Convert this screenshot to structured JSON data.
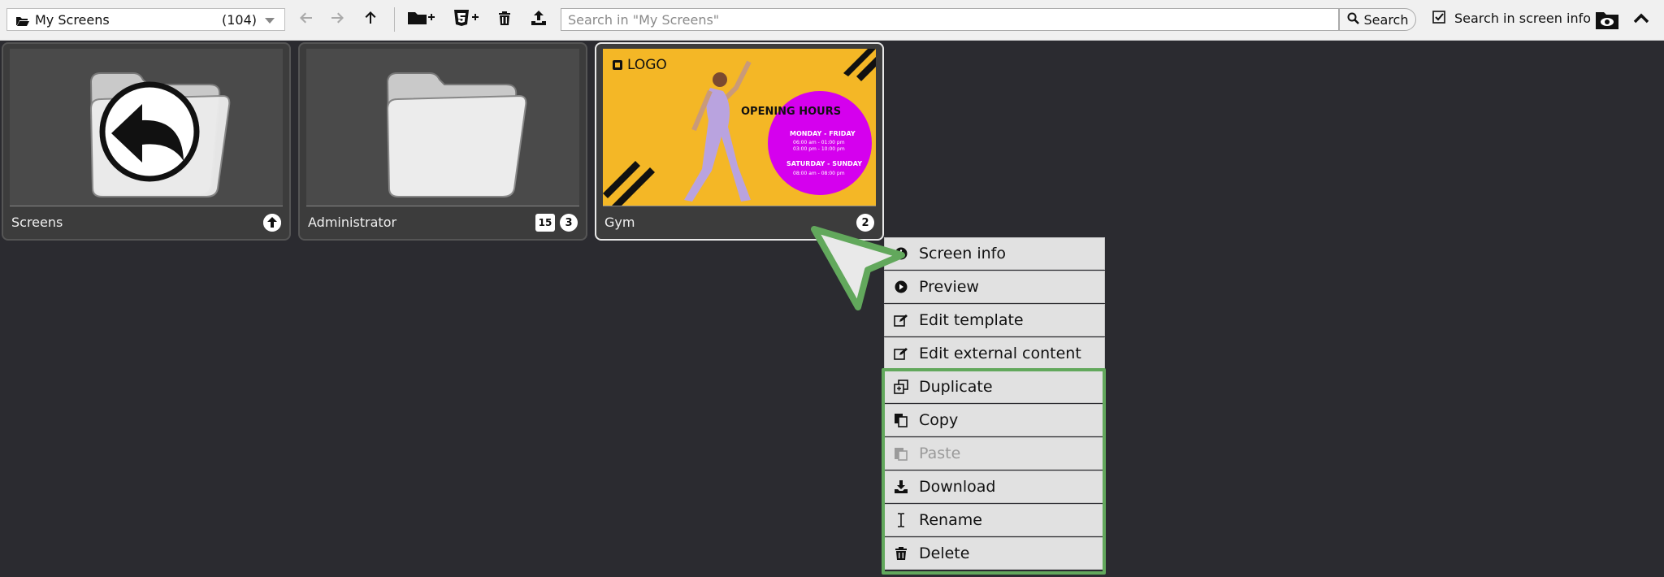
{
  "toolbar": {
    "folder_name": "My Screens",
    "folder_count": "(104)",
    "search_placeholder": "Search in \"My Screens\"",
    "search_button": "Search",
    "search_in_info_label": "Search in screen info",
    "search_in_info_checked": true,
    "icons": [
      "open-folder-icon",
      "back-arrow-icon",
      "forward-arrow-icon",
      "up-arrow-icon",
      "new-folder-icon",
      "new-html5-screen-icon",
      "trash-icon",
      "upload-icon",
      "search-icon",
      "checkbox-icon",
      "folder-eye-icon",
      "chevron-up-icon"
    ]
  },
  "tiles": [
    {
      "label": "Screens",
      "icon": "up-arrow-circle-icon"
    },
    {
      "label": "Administrator",
      "badge_screens": "15",
      "badge_folders": "3"
    },
    {
      "label": "Gym",
      "badge": "2",
      "selected": true,
      "poster": {
        "logo": "LOGO",
        "heading": "OPENING HOURS",
        "days1": "MONDAY - FRIDAY",
        "time1": "06:00 am - 01:00 pm",
        "time2": "03:00 pm - 10:00 pm",
        "days2": "SATURDAY - SUNDAY",
        "time3": "08:00 am - 08:00 pm",
        "colors": {
          "background": "#f4b726",
          "circle": "#d500ee"
        }
      }
    }
  ],
  "context_menu": {
    "items": [
      {
        "label": "Screen info",
        "icon": "info-icon"
      },
      {
        "label": "Preview",
        "icon": "play-icon"
      },
      {
        "label": "Edit template",
        "icon": "edit-icon"
      },
      {
        "label": "Edit external content",
        "icon": "edit-icon"
      },
      {
        "label": "Duplicate",
        "icon": "duplicate-icon"
      },
      {
        "label": "Copy",
        "icon": "copy-icon"
      },
      {
        "label": "Paste",
        "icon": "paste-icon",
        "disabled": true
      },
      {
        "label": "Download",
        "icon": "download-icon"
      },
      {
        "label": "Rename",
        "icon": "text-cursor-icon"
      },
      {
        "label": "Delete",
        "icon": "trash-icon"
      }
    ],
    "highlight_color": "#62a85c"
  }
}
